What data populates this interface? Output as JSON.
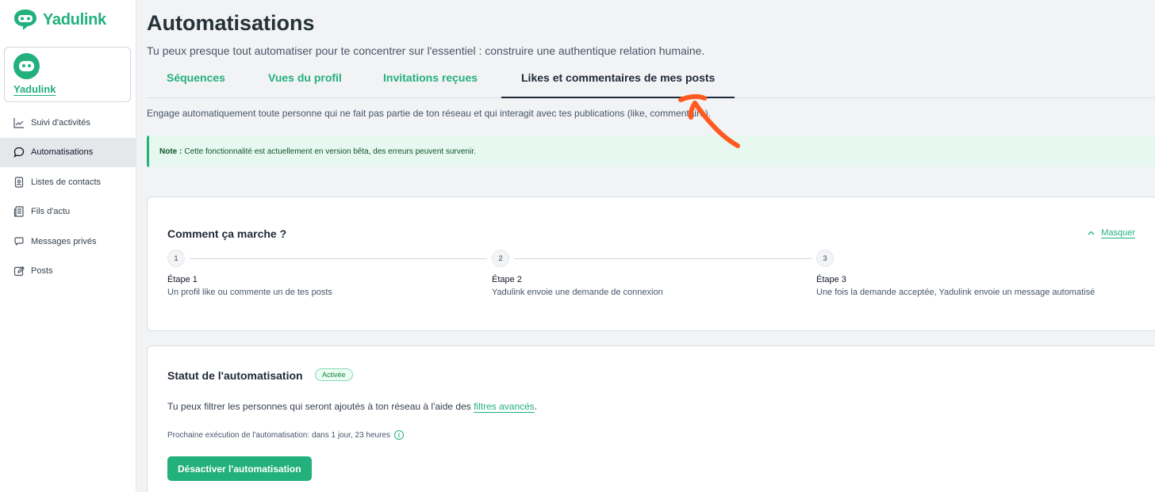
{
  "brand": {
    "name": "Yadulink"
  },
  "account": {
    "name": "Yadulink"
  },
  "sidebar": {
    "items": [
      {
        "label": "Suivi d'activités",
        "icon": "chart-line-icon",
        "active": false
      },
      {
        "label": "Automatisations",
        "icon": "chat-bubble-icon",
        "active": true
      },
      {
        "label": "Listes de contacts",
        "icon": "contact-card-icon",
        "active": false
      },
      {
        "label": "Fils d'actu",
        "icon": "newspaper-icon",
        "active": false
      },
      {
        "label": "Messages privés",
        "icon": "messages-icon",
        "active": false
      },
      {
        "label": "Posts",
        "icon": "edit-icon",
        "active": false
      }
    ]
  },
  "header": {
    "title": "Automatisations",
    "subtitle": "Tu peux presque tout automatiser pour te concentrer sur l'essentiel : construire une authentique relation humaine."
  },
  "tabs": [
    {
      "label": "Séquences",
      "active": false
    },
    {
      "label": "Vues du profil",
      "active": false
    },
    {
      "label": "Invitations reçues",
      "active": false
    },
    {
      "label": "Likes et commentaires de mes posts",
      "active": true
    }
  ],
  "description": "Engage automatiquement toute personne qui ne fait pas partie de ton réseau et qui interagit avec tes publications (like, commentaire).",
  "note": {
    "prefix": "Note :",
    "text": "Cette fonctionnalité est actuellement en version bêta, des erreurs peuvent survenir."
  },
  "how_it_works": {
    "title": "Comment ça marche ?",
    "hide_label": "Masquer",
    "steps": [
      {
        "number": "1",
        "title": "Étape 1",
        "description": "Un profil like ou commente un de tes posts"
      },
      {
        "number": "2",
        "title": "Étape 2",
        "description": "Yadulink envoie une demande de connexion"
      },
      {
        "number": "3",
        "title": "Étape 3",
        "description": "Une fois la demande acceptée, Yadulink envoie un message automatisé"
      }
    ]
  },
  "status": {
    "title": "Statut de l'automatisation",
    "badge": "Activée",
    "filter_text_before": "Tu peux filtrer les personnes qui seront ajoutés à ton réseau à l'aide des",
    "filter_link": "filtres avancés",
    "filter_text_after": ".",
    "next_run": "Prochaine exécution de l'automatisation: dans 1 jour, 23 heures",
    "deactivate_label": "Désactiver l'automatisation"
  },
  "colors": {
    "accent": "#22b07d",
    "annotation": "#ff5a1f"
  }
}
